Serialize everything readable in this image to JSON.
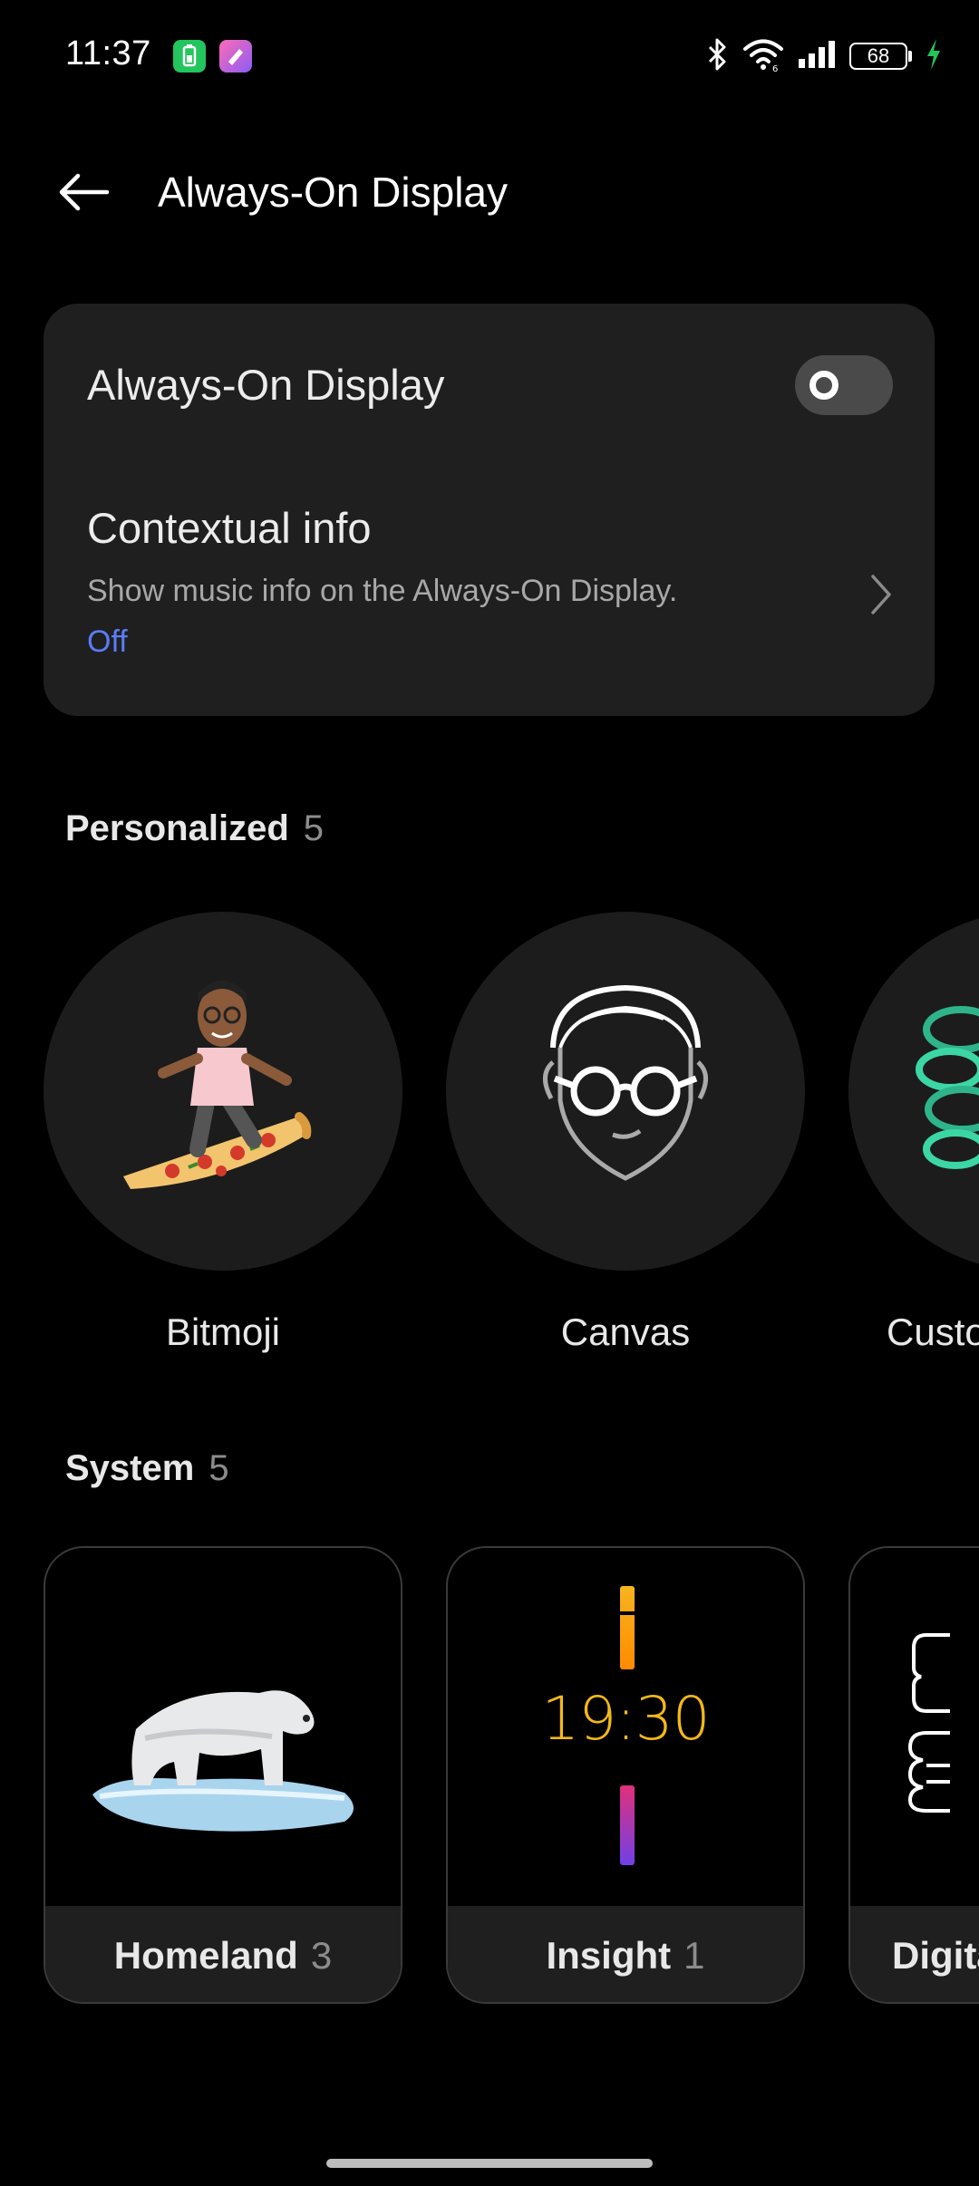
{
  "status_bar": {
    "time": "11:37",
    "battery_level": "68",
    "icons": [
      "battery-saver-icon",
      "app-icon",
      "bluetooth-icon",
      "wifi-icon",
      "signal-icon",
      "battery-icon",
      "charging-icon"
    ]
  },
  "header": {
    "title": "Always-On Display",
    "back_icon": "arrow-left-icon"
  },
  "settings": {
    "always_on_display": {
      "label": "Always-On Display",
      "enabled": false
    },
    "contextual_info": {
      "title": "Contextual info",
      "description": "Show music info on the Always-On Display.",
      "status": "Off"
    }
  },
  "personalized": {
    "title": "Personalized",
    "count": "5",
    "items": [
      {
        "label": "Bitmoji",
        "icon": "bitmoji-surfer-image"
      },
      {
        "label": "Canvas",
        "icon": "face-outline-icon"
      },
      {
        "label": "Custo",
        "icon": "custom-flower-icon"
      }
    ]
  },
  "system": {
    "title": "System",
    "count": "5",
    "items": [
      {
        "label": "Homeland",
        "count": "3",
        "icon": "polar-bear-image"
      },
      {
        "label": "Insight",
        "count": "1",
        "preview_time": "19:30"
      },
      {
        "label": "Digita",
        "count": "",
        "icon": "digital-outline-icon"
      }
    ]
  },
  "colors": {
    "background": "#000000",
    "card": "#1f1f1f",
    "accent": "#5b7cf5",
    "insight_time": "#f5b818"
  }
}
